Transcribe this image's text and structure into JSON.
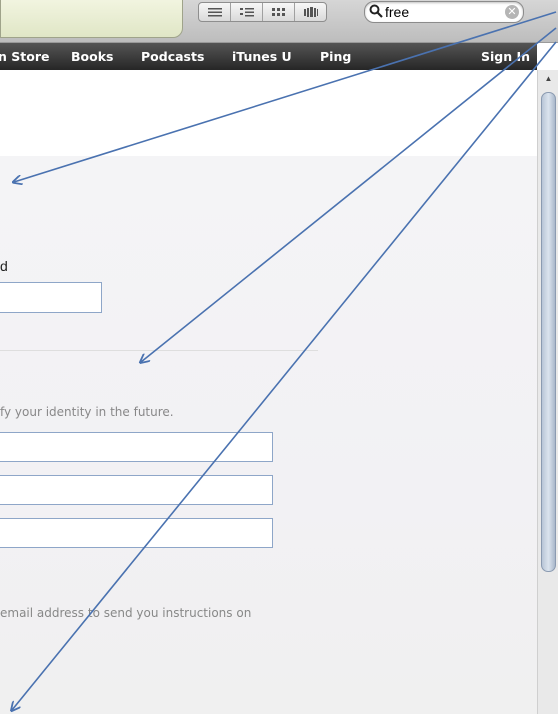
{
  "toolbar": {
    "search": {
      "value": "free"
    }
  },
  "navbar": {
    "items": [
      "n Store",
      "Books",
      "Podcasts",
      "iTunes U",
      "Ping"
    ],
    "sign_in": "Sign In"
  },
  "form": {
    "password_label": "d",
    "security_hint": "fy your identity in the future.",
    "email_hint": "email address to send you instructions on"
  },
  "colors": {
    "annotation_arrow": "#4a72b0",
    "field_border": "#8ea6c8",
    "navbar": "#333333"
  }
}
